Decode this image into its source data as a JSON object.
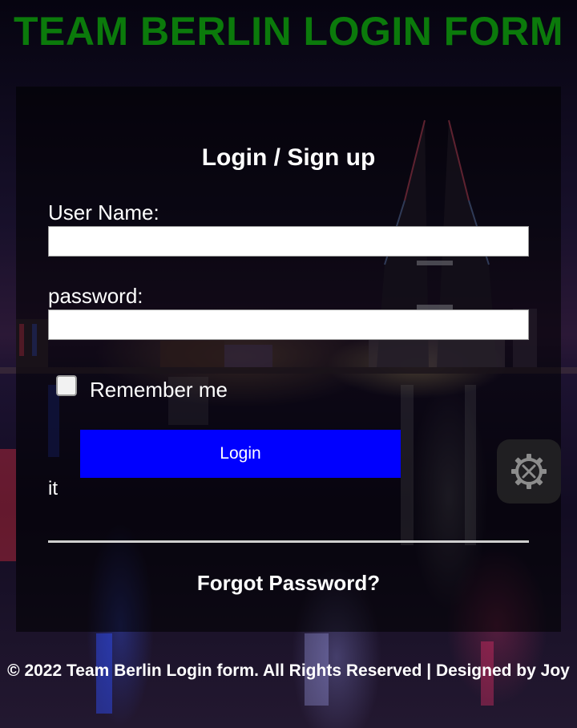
{
  "page": {
    "title": "TEAM BERLIN LOGIN FORM"
  },
  "form": {
    "heading": "Login / Sign up",
    "username_label": "User Name:",
    "username_value": "",
    "password_label": "password:",
    "password_value": "",
    "remember_label": "Remember me",
    "remember_checked": false,
    "login_label": "Login",
    "stray_text": "it",
    "forgot_label": "Forgot Password?"
  },
  "floating_button": {
    "icon": "settings-tools-icon"
  },
  "footer": {
    "text": "© 2022 Team Berlin Login form. All Rights Reserved | Designed by Joy"
  },
  "colors": {
    "title": "#0b7a0b",
    "login_button": "#0000ff",
    "panel": "rgba(0,0,0,0.55)"
  }
}
